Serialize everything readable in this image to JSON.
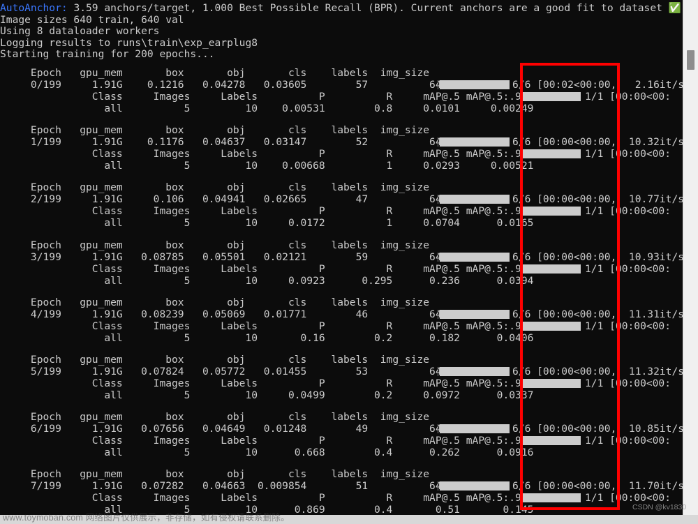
{
  "terminal": {
    "preamble": [
      {
        "prefix": "AutoAnchor:",
        "text": " 3.59 anchors/target, 1.000 Best Possible Recall (BPR). Current anchors are a good fit to dataset ✅"
      },
      {
        "prefix": "",
        "text": "Image sizes 640 train, 640 val"
      },
      {
        "prefix": "",
        "text": "Using 8 dataloader workers"
      },
      {
        "prefix": "",
        "text": "Logging results to runs\\train\\exp_earplug8"
      },
      {
        "prefix": "",
        "text": "Starting training for 200 epochs..."
      }
    ],
    "train_header": "     Epoch   gpu_mem       box       obj       cls    labels  img_size",
    "val_header": "               Class     Images     Labels          P          R     mAP@.5 mAP@.5:.95:",
    "epochs": [
      {
        "epoch": "0/199",
        "gpu_mem": "1.91G",
        "box": "0.1216",
        "obj": "0.04278",
        "cls": "0.03605",
        "labels": "57",
        "img_size": "640",
        "train_pct": "100%",
        "train_count": "6/6",
        "train_time": "[00:02<00:00,",
        "train_rate": "2.16it/s]",
        "val_pct": "100%",
        "val_count": "1/1",
        "val_time": "[00:00<00:",
        "cls_name": "all",
        "images": "5",
        "val_labels": "10",
        "P": "0.00531",
        "R": "0.8",
        "mAP50": "0.0101",
        "mAP5095": "0.00249"
      },
      {
        "epoch": "1/199",
        "gpu_mem": "1.91G",
        "box": "0.1176",
        "obj": "0.04637",
        "cls": "0.03147",
        "labels": "52",
        "img_size": "640",
        "train_pct": "100%",
        "train_count": "6/6",
        "train_time": "[00:00<00:00,",
        "train_rate": "10.32it/s]",
        "val_pct": "100%",
        "val_count": "1/1",
        "val_time": "[00:00<00:",
        "cls_name": "all",
        "images": "5",
        "val_labels": "10",
        "P": "0.00668",
        "R": "1",
        "mAP50": "0.0293",
        "mAP5095": "0.00521"
      },
      {
        "epoch": "2/199",
        "gpu_mem": "1.91G",
        "box": "0.106",
        "obj": "0.04941",
        "cls": "0.02665",
        "labels": "47",
        "img_size": "640",
        "train_pct": "100%",
        "train_count": "6/6",
        "train_time": "[00:00<00:00,",
        "train_rate": "10.77it/s]",
        "val_pct": "100%",
        "val_count": "1/1",
        "val_time": "[00:00<00:",
        "cls_name": "all",
        "images": "5",
        "val_labels": "10",
        "P": "0.0172",
        "R": "1",
        "mAP50": "0.0704",
        "mAP5095": "0.0165"
      },
      {
        "epoch": "3/199",
        "gpu_mem": "1.91G",
        "box": "0.08785",
        "obj": "0.05501",
        "cls": "0.02121",
        "labels": "59",
        "img_size": "640",
        "train_pct": "100%",
        "train_count": "6/6",
        "train_time": "[00:00<00:00,",
        "train_rate": "10.93it/s]",
        "val_pct": "100%",
        "val_count": "1/1",
        "val_time": "[00:00<00:",
        "cls_name": "all",
        "images": "5",
        "val_labels": "10",
        "P": "0.0923",
        "R": "0.295",
        "mAP50": "0.236",
        "mAP5095": "0.0394"
      },
      {
        "epoch": "4/199",
        "gpu_mem": "1.91G",
        "box": "0.08239",
        "obj": "0.05069",
        "cls": "0.01771",
        "labels": "46",
        "img_size": "640",
        "train_pct": "100%",
        "train_count": "6/6",
        "train_time": "[00:00<00:00,",
        "train_rate": "11.31it/s]",
        "val_pct": "100%",
        "val_count": "1/1",
        "val_time": "[00:00<00:",
        "cls_name": "all",
        "images": "5",
        "val_labels": "10",
        "P": "0.16",
        "R": "0.2",
        "mAP50": "0.182",
        "mAP5095": "0.0406"
      },
      {
        "epoch": "5/199",
        "gpu_mem": "1.91G",
        "box": "0.07824",
        "obj": "0.05772",
        "cls": "0.01455",
        "labels": "53",
        "img_size": "640",
        "train_pct": "100%",
        "train_count": "6/6",
        "train_time": "[00:00<00:00,",
        "train_rate": "11.32it/s]",
        "val_pct": "100%",
        "val_count": "1/1",
        "val_time": "[00:00<00:",
        "cls_name": "all",
        "images": "5",
        "val_labels": "10",
        "P": "0.0499",
        "R": "0.2",
        "mAP50": "0.0972",
        "mAP5095": "0.0337"
      },
      {
        "epoch": "6/199",
        "gpu_mem": "1.91G",
        "box": "0.07656",
        "obj": "0.04649",
        "cls": "0.01248",
        "labels": "49",
        "img_size": "640",
        "train_pct": "100%",
        "train_count": "6/6",
        "train_time": "[00:00<00:00,",
        "train_rate": "10.85it/s]",
        "val_pct": "100%",
        "val_count": "1/1",
        "val_time": "[00:00<00:",
        "cls_name": "all",
        "images": "5",
        "val_labels": "10",
        "P": "0.668",
        "R": "0.4",
        "mAP50": "0.262",
        "mAP5095": "0.0916"
      },
      {
        "epoch": "7/199",
        "gpu_mem": "1.91G",
        "box": "0.07282",
        "obj": "0.04663",
        "cls": "0.009854",
        "labels": "51",
        "img_size": "640",
        "train_pct": "100%",
        "train_count": "6/6",
        "train_time": "[00:00<00:00,",
        "train_rate": "11.70it/s]",
        "val_pct": "100%",
        "val_count": "1/1",
        "val_time": "[00:00<00:",
        "cls_name": "all",
        "images": "5",
        "val_labels": "10",
        "P": "0.869",
        "R": "0.4",
        "mAP50": "0.51",
        "mAP5095": "0.145"
      }
    ]
  },
  "annotation": {
    "color": "#ff0000"
  },
  "watermarks": {
    "csdn": "CSDN @kv1830",
    "toymoban": "www.toymoban.com 网络图片仅供展示，非存储，如有侵权请联系删除。"
  },
  "colors": {
    "terminal_bg": "#0c0c0c",
    "terminal_fg": "#cccccc",
    "accent_blue": "#3b78ff",
    "progress_fill": "#cccccc"
  }
}
